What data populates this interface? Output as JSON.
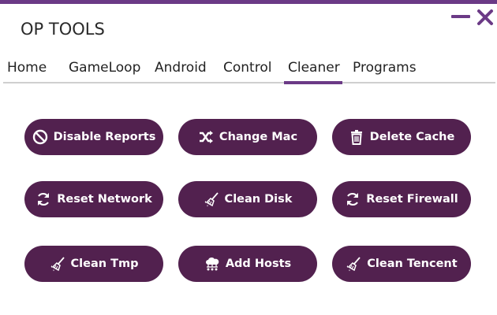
{
  "window": {
    "title": "OP TOOLS",
    "accent_color": "#6b3a86",
    "button_color": "#52214f"
  },
  "tabs": [
    {
      "label": "Home"
    },
    {
      "label": "GameLoop"
    },
    {
      "label": "Android"
    },
    {
      "label": "Control"
    },
    {
      "label": "Cleaner",
      "active": true
    },
    {
      "label": "Programs"
    }
  ],
  "actions": [
    {
      "label": "Disable Reports",
      "icon": "ban-icon"
    },
    {
      "label": "Change Mac",
      "icon": "shuffle-icon"
    },
    {
      "label": "Delete Cache",
      "icon": "trash-icon"
    },
    {
      "label": "Reset Network",
      "icon": "refresh-icon"
    },
    {
      "label": "Clean Disk",
      "icon": "broom-icon"
    },
    {
      "label": "Reset Firewall",
      "icon": "refresh-icon"
    },
    {
      "label": "Clean Tmp",
      "icon": "broom-icon"
    },
    {
      "label": "Add Hosts",
      "icon": "cloud-network-icon"
    },
    {
      "label": "Clean Tencent",
      "icon": "broom-icon"
    }
  ]
}
